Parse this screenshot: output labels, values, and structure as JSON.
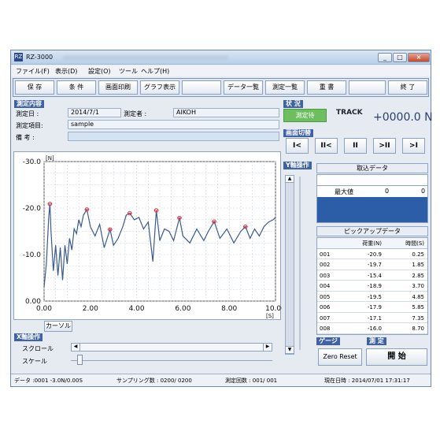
{
  "window": {
    "title": "RZ-3000",
    "app_icon": "RZ",
    "buttons": [
      "_",
      "□",
      "×"
    ]
  },
  "menu": [
    "ファイル(F)",
    "表示(D)",
    "設定(O)",
    "ツール",
    "ヘルプ(H)"
  ],
  "toolbar": [
    "保 存",
    "条 件",
    "画面印刷",
    "グラフ表示",
    "データ一覧",
    "測定一覧",
    "重 書",
    "終 了"
  ],
  "measure": {
    "section": "測定内容",
    "date_label": "測定日 :",
    "date": "2014/7/1",
    "person_label": "測定者 :",
    "person": "AIKOH",
    "item_label": "測定項目:",
    "item": "sample",
    "note_label": "備 考 :",
    "note": ""
  },
  "status": {
    "section": "状 況",
    "state": "測定待",
    "mode": "TRACK",
    "force": "+0000.0 N"
  },
  "screen_switch": {
    "section": "画面切替",
    "buttons": [
      "I<",
      "II<",
      "II",
      ">II",
      ">I"
    ]
  },
  "yaxis_op": "Y軸操作",
  "xaxis_op": "X軸操作",
  "scroll_label": "スクロール",
  "scale_label": "スケール",
  "cursor_button": "カーソル",
  "capture": {
    "title": "取込データ",
    "max_label": "最大値",
    "max_a": "0",
    "max_b": "0"
  },
  "pickup": {
    "title": "ピックアップデータ",
    "headers": [
      "",
      "荷重(N)",
      "時間(S)"
    ],
    "rows": [
      [
        "001",
        "-20.9",
        "0.25"
      ],
      [
        "002",
        "-19.7",
        "1.85"
      ],
      [
        "003",
        "-15.4",
        "2.85"
      ],
      [
        "004",
        "-18.9",
        "3.70"
      ],
      [
        "005",
        "-19.5",
        "4.85"
      ],
      [
        "006",
        "-17.9",
        "5.85"
      ],
      [
        "007",
        "-17.1",
        "7.35"
      ],
      [
        "008",
        "-16.0",
        "8.70"
      ]
    ]
  },
  "gauge_label": "ゲージ",
  "measure_label": "測 定",
  "zero_reset": "Zero Reset",
  "start_button": "開 始",
  "statusbar": {
    "data": "データ :0001 -3.0N/0.00S",
    "sampling": "サンプリング数 : 0200/ 0200",
    "count": "測定回数 : 001/ 001",
    "datetime": "現在日時 : 2014/07/01 17:31:17"
  },
  "chart_data": {
    "type": "line",
    "ylabel": "[N]",
    "xlabel": "[S]",
    "xlim": [
      0,
      10
    ],
    "ylim": [
      -30,
      0
    ],
    "y_inverted": true,
    "grid": true,
    "x_ticks": [
      "0.00",
      "2.00",
      "4.00",
      "6.00",
      "8.00",
      "10.00"
    ],
    "y_ticks": [
      "-30.0",
      "-20.0",
      "-10.0",
      "0.00"
    ],
    "line_color": "#3a5a8c",
    "marker_color": "#e0303a",
    "series": [
      {
        "x": [
          0,
          0.1,
          0.2,
          0.25,
          0.3,
          0.4,
          0.5,
          0.6,
          0.7,
          0.8,
          0.9,
          1.0,
          1.1,
          1.2,
          1.3,
          1.4,
          1.5,
          1.6,
          1.7,
          1.85,
          2.0,
          2.2,
          2.4,
          2.6,
          2.85,
          3.0,
          3.2,
          3.4,
          3.55,
          3.7,
          3.9,
          4.1,
          4.3,
          4.5,
          4.7,
          4.85,
          5.0,
          5.2,
          5.4,
          5.6,
          5.85,
          6.0,
          6.3,
          6.6,
          6.9,
          7.1,
          7.35,
          7.6,
          7.9,
          8.2,
          8.5,
          8.7,
          8.9,
          9.1,
          9.3,
          9.5,
          9.7,
          9.9,
          10.0
        ],
        "y": [
          -3.0,
          -8.0,
          -18.0,
          -20.9,
          -15.0,
          -6.5,
          -12.0,
          -5.5,
          -11.5,
          -4.5,
          -12.0,
          -8.0,
          -13.5,
          -11.0,
          -15.5,
          -14.5,
          -17.5,
          -16.0,
          -18.5,
          -19.7,
          -16.0,
          -14.0,
          -16.5,
          -11.5,
          -15.4,
          -12.0,
          -13.5,
          -16.0,
          -18.5,
          -18.9,
          -17.5,
          -18.0,
          -15.5,
          -17.0,
          -8.5,
          -19.5,
          -13.0,
          -15.5,
          -15.0,
          -13.0,
          -17.9,
          -14.0,
          -12.5,
          -15.5,
          -13.0,
          -15.0,
          -17.1,
          -13.5,
          -15.5,
          -12.5,
          -15.0,
          -16.0,
          -13.5,
          -15.5,
          -14.0,
          -16.0,
          -17.0,
          -17.5,
          -18.0
        ]
      }
    ],
    "markers_x": [
      0.25,
      1.85,
      2.85,
      3.7,
      4.85,
      5.85,
      7.35,
      8.7
    ],
    "markers_y": [
      -20.9,
      -19.7,
      -15.4,
      -18.9,
      -19.5,
      -17.9,
      -17.1,
      -16.0
    ]
  }
}
